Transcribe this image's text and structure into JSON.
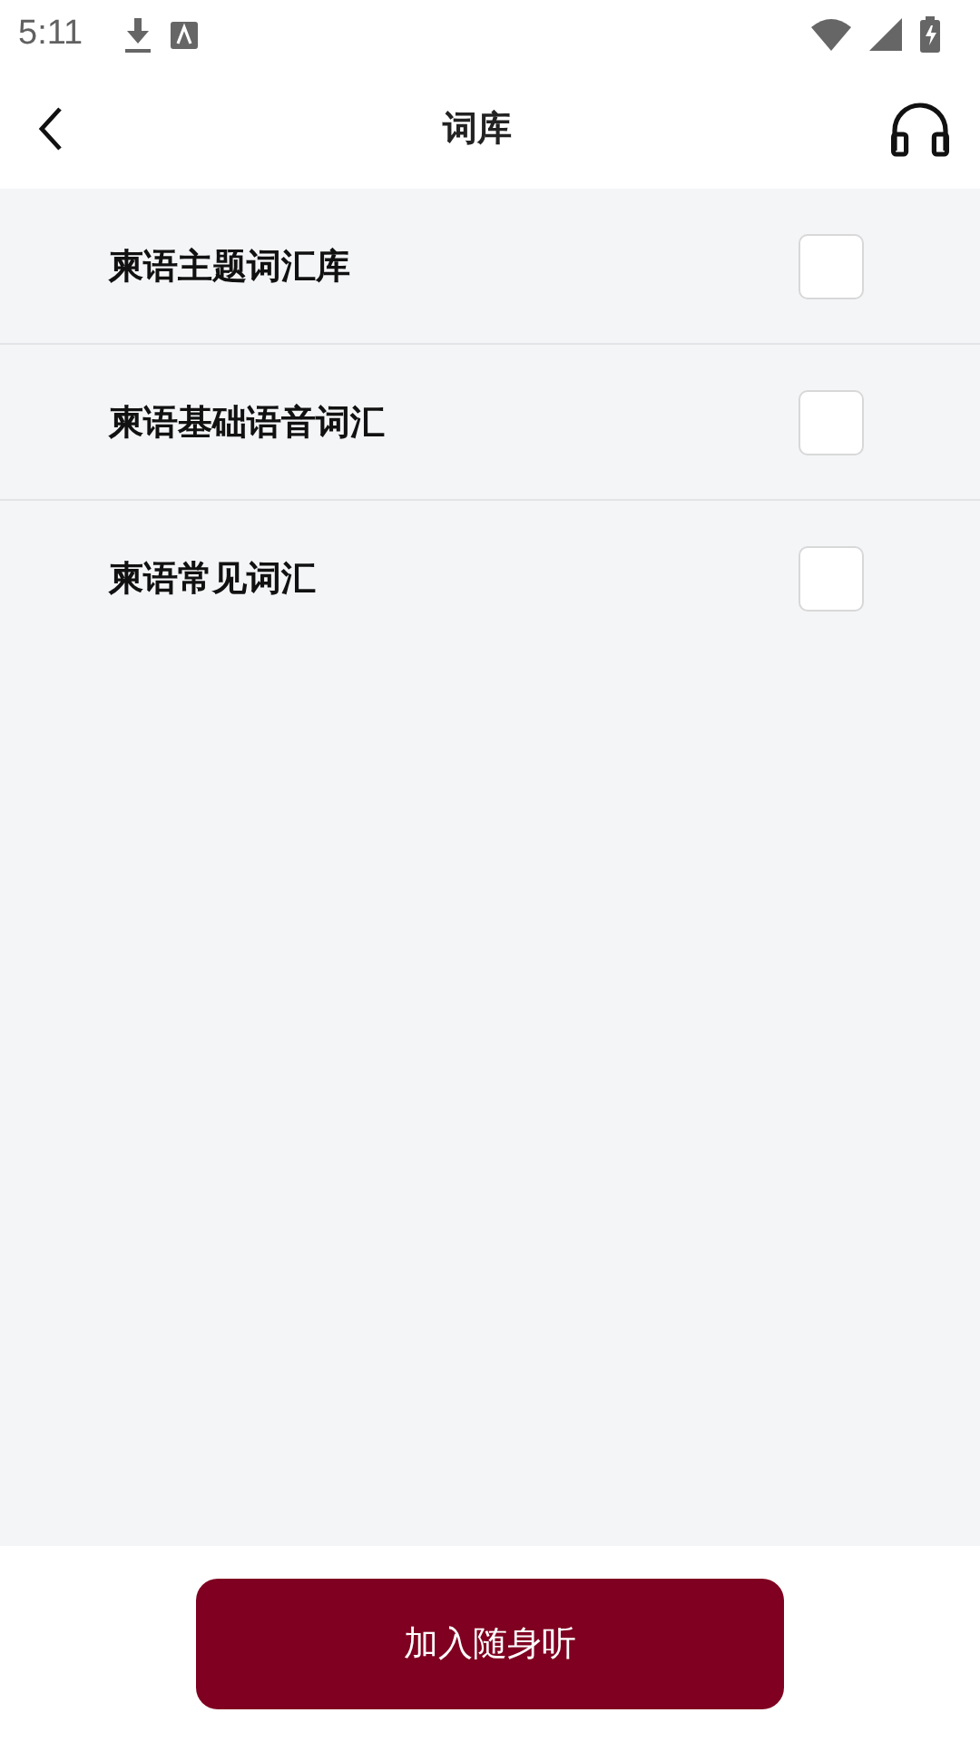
{
  "status_bar": {
    "time": "5:11"
  },
  "header": {
    "title": "词库"
  },
  "items": [
    {
      "label": "柬语主题词汇库",
      "checked": false
    },
    {
      "label": "柬语基础语音词汇",
      "checked": false
    },
    {
      "label": "柬语常见词汇",
      "checked": false
    }
  ],
  "action_button": {
    "label": "加入随身听"
  }
}
